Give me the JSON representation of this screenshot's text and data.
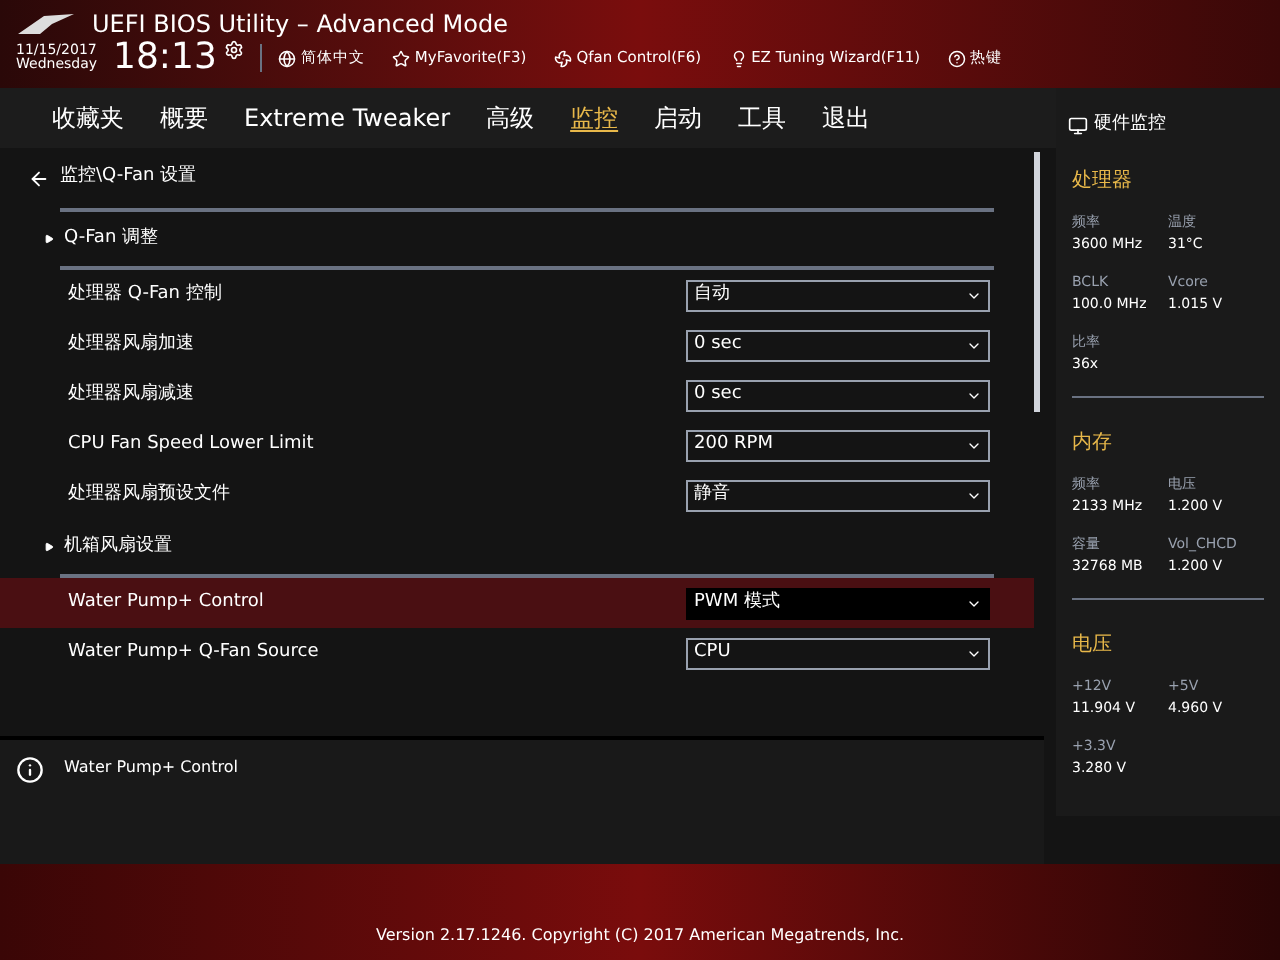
{
  "window": {
    "title": "UEFI BIOS Utility – Advanced Mode"
  },
  "toolbar": {
    "date": "11/15/2017",
    "weekday": "Wednesday",
    "time": "18:13",
    "items": [
      {
        "kind": "globe",
        "label": "简体中文"
      },
      {
        "kind": "favorite",
        "label": "MyFavorite(F3)"
      },
      {
        "kind": "fan",
        "label": "Qfan Control(F6)"
      },
      {
        "kind": "bulb",
        "label": "EZ Tuning Wizard(F11)"
      },
      {
        "kind": "help",
        "label": "热键"
      }
    ]
  },
  "tabs": [
    {
      "label": "收藏夹",
      "selected": false
    },
    {
      "label": "概要",
      "selected": false
    },
    {
      "label": "Extreme Tweaker",
      "selected": false
    },
    {
      "label": "高级",
      "selected": false
    },
    {
      "label": "监控",
      "selected": true
    },
    {
      "label": "启动",
      "selected": false
    },
    {
      "label": "工具",
      "selected": false
    },
    {
      "label": "退出",
      "selected": false
    }
  ],
  "breadcrumb": "监控\\Q-Fan 设置",
  "settings": [
    {
      "kind": "section",
      "label": "Q-Fan 调整"
    },
    {
      "kind": "option",
      "label": "处理器 Q-Fan 控制",
      "value": "自动",
      "selected": false
    },
    {
      "kind": "option",
      "label": "处理器风扇加速",
      "value": "0 sec",
      "selected": false
    },
    {
      "kind": "option",
      "label": "处理器风扇减速",
      "value": "0 sec",
      "selected": false
    },
    {
      "kind": "option",
      "label": "CPU Fan Speed Lower Limit",
      "value": "200 RPM",
      "selected": false
    },
    {
      "kind": "option",
      "label": "处理器风扇预设文件",
      "value": "静音",
      "selected": false
    },
    {
      "kind": "section",
      "label": "机箱风扇设置"
    },
    {
      "kind": "option",
      "label": "Water Pump+ Control",
      "value": "PWM 模式",
      "selected": true
    },
    {
      "kind": "option",
      "label": "Water Pump+ Q-Fan Source",
      "value": "CPU",
      "selected": false
    }
  ],
  "help_text": "Water Pump+ Control",
  "hardware_monitor": {
    "title": "硬件监控",
    "groups": [
      {
        "title": "处理器",
        "readings": [
          {
            "label": "频率",
            "value": "3600 MHz"
          },
          {
            "label": "温度",
            "value": "31°C"
          },
          {
            "label": "BCLK",
            "value": "100.0 MHz"
          },
          {
            "label": "Vcore",
            "value": "1.015 V"
          },
          {
            "label": "比率",
            "value": "36x"
          }
        ]
      },
      {
        "title": "内存",
        "readings": [
          {
            "label": "频率",
            "value": "2133 MHz"
          },
          {
            "label": "电压",
            "value": "1.200 V"
          },
          {
            "label": "容量",
            "value": "32768 MB"
          },
          {
            "label": "Vol_CHCD",
            "value": "1.200 V"
          }
        ]
      },
      {
        "title": "电压",
        "readings": [
          {
            "label": "+12V",
            "value": "11.904 V"
          },
          {
            "label": "+5V",
            "value": "4.960 V"
          },
          {
            "label": "+3.3V",
            "value": "3.280 V"
          }
        ]
      }
    ]
  },
  "footer": "Version 2.17.1246. Copyright (C) 2017 American Megatrends, Inc."
}
